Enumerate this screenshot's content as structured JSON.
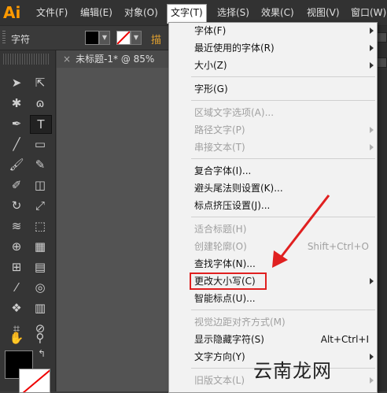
{
  "menubar": {
    "logo": "Ai",
    "items": [
      "文件(F)",
      "编辑(E)",
      "对象(O)",
      "文字(T)",
      "选择(S)",
      "效果(C)",
      "视图(V)",
      "窗口(W)"
    ]
  },
  "control": {
    "label": "字符",
    "extra": "描"
  },
  "document": {
    "tab_title": "未标题-1* @ 85% (CM"
  },
  "menu": {
    "items": [
      {
        "label": "字体(F)"
      },
      {
        "label": "最近使用的字体(R)"
      },
      {
        "label": "大小(Z)"
      },
      {
        "label": "字形(G)"
      },
      {
        "label": "区域文字选项(A)..."
      },
      {
        "label": "路径文字(P)"
      },
      {
        "label": "串接文本(T)"
      },
      {
        "label": "复合字体(I)..."
      },
      {
        "label": "避头尾法则设置(K)..."
      },
      {
        "label": "标点挤压设置(J)..."
      },
      {
        "label": "适合标题(H)"
      },
      {
        "label": "创建轮廓(O)",
        "shortcut": "Shift+Ctrl+O"
      },
      {
        "label": "查找字体(N)..."
      },
      {
        "label": "更改大小写(C)"
      },
      {
        "label": "智能标点(U)..."
      },
      {
        "label": "视觉边距对齐方式(M)"
      },
      {
        "label": "显示隐藏字符(S)",
        "shortcut": "Alt+Ctrl+I"
      },
      {
        "label": "文字方向(Y)"
      },
      {
        "label": "旧版文本(L)"
      }
    ]
  },
  "watermark": "云南龙网",
  "colors": {
    "highlight": "#e02020",
    "pointer": "#e02020",
    "logo": "#ff9a00"
  }
}
